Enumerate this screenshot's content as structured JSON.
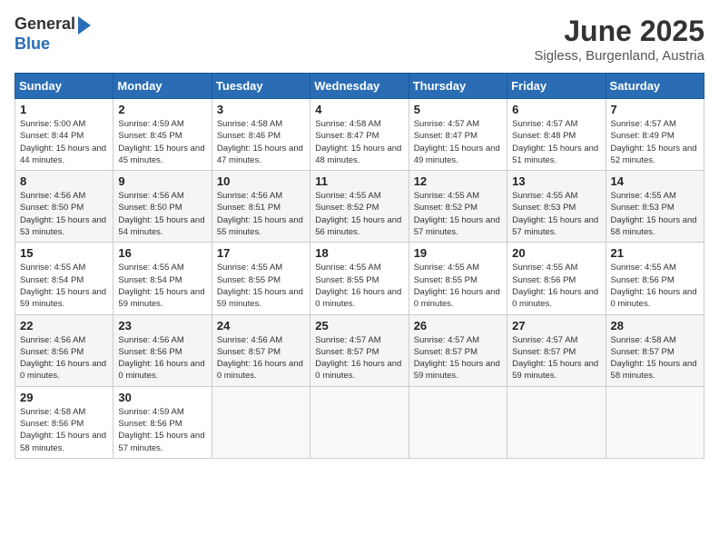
{
  "header": {
    "logo_general": "General",
    "logo_blue": "Blue",
    "month_title": "June 2025",
    "subtitle": "Sigless, Burgenland, Austria"
  },
  "weekdays": [
    "Sunday",
    "Monday",
    "Tuesday",
    "Wednesday",
    "Thursday",
    "Friday",
    "Saturday"
  ],
  "weeks": [
    [
      {
        "day": "1",
        "sunrise": "5:00 AM",
        "sunset": "8:44 PM",
        "daylight": "15 hours and 44 minutes."
      },
      {
        "day": "2",
        "sunrise": "4:59 AM",
        "sunset": "8:45 PM",
        "daylight": "15 hours and 45 minutes."
      },
      {
        "day": "3",
        "sunrise": "4:58 AM",
        "sunset": "8:46 PM",
        "daylight": "15 hours and 47 minutes."
      },
      {
        "day": "4",
        "sunrise": "4:58 AM",
        "sunset": "8:47 PM",
        "daylight": "15 hours and 48 minutes."
      },
      {
        "day": "5",
        "sunrise": "4:57 AM",
        "sunset": "8:47 PM",
        "daylight": "15 hours and 49 minutes."
      },
      {
        "day": "6",
        "sunrise": "4:57 AM",
        "sunset": "8:48 PM",
        "daylight": "15 hours and 51 minutes."
      },
      {
        "day": "7",
        "sunrise": "4:57 AM",
        "sunset": "8:49 PM",
        "daylight": "15 hours and 52 minutes."
      }
    ],
    [
      {
        "day": "8",
        "sunrise": "4:56 AM",
        "sunset": "8:50 PM",
        "daylight": "15 hours and 53 minutes."
      },
      {
        "day": "9",
        "sunrise": "4:56 AM",
        "sunset": "8:50 PM",
        "daylight": "15 hours and 54 minutes."
      },
      {
        "day": "10",
        "sunrise": "4:56 AM",
        "sunset": "8:51 PM",
        "daylight": "15 hours and 55 minutes."
      },
      {
        "day": "11",
        "sunrise": "4:55 AM",
        "sunset": "8:52 PM",
        "daylight": "15 hours and 56 minutes."
      },
      {
        "day": "12",
        "sunrise": "4:55 AM",
        "sunset": "8:52 PM",
        "daylight": "15 hours and 57 minutes."
      },
      {
        "day": "13",
        "sunrise": "4:55 AM",
        "sunset": "8:53 PM",
        "daylight": "15 hours and 57 minutes."
      },
      {
        "day": "14",
        "sunrise": "4:55 AM",
        "sunset": "8:53 PM",
        "daylight": "15 hours and 58 minutes."
      }
    ],
    [
      {
        "day": "15",
        "sunrise": "4:55 AM",
        "sunset": "8:54 PM",
        "daylight": "15 hours and 59 minutes."
      },
      {
        "day": "16",
        "sunrise": "4:55 AM",
        "sunset": "8:54 PM",
        "daylight": "15 hours and 59 minutes."
      },
      {
        "day": "17",
        "sunrise": "4:55 AM",
        "sunset": "8:55 PM",
        "daylight": "15 hours and 59 minutes."
      },
      {
        "day": "18",
        "sunrise": "4:55 AM",
        "sunset": "8:55 PM",
        "daylight": "16 hours and 0 minutes."
      },
      {
        "day": "19",
        "sunrise": "4:55 AM",
        "sunset": "8:55 PM",
        "daylight": "16 hours and 0 minutes."
      },
      {
        "day": "20",
        "sunrise": "4:55 AM",
        "sunset": "8:56 PM",
        "daylight": "16 hours and 0 minutes."
      },
      {
        "day": "21",
        "sunrise": "4:55 AM",
        "sunset": "8:56 PM",
        "daylight": "16 hours and 0 minutes."
      }
    ],
    [
      {
        "day": "22",
        "sunrise": "4:56 AM",
        "sunset": "8:56 PM",
        "daylight": "16 hours and 0 minutes."
      },
      {
        "day": "23",
        "sunrise": "4:56 AM",
        "sunset": "8:56 PM",
        "daylight": "16 hours and 0 minutes."
      },
      {
        "day": "24",
        "sunrise": "4:56 AM",
        "sunset": "8:57 PM",
        "daylight": "16 hours and 0 minutes."
      },
      {
        "day": "25",
        "sunrise": "4:57 AM",
        "sunset": "8:57 PM",
        "daylight": "16 hours and 0 minutes."
      },
      {
        "day": "26",
        "sunrise": "4:57 AM",
        "sunset": "8:57 PM",
        "daylight": "15 hours and 59 minutes."
      },
      {
        "day": "27",
        "sunrise": "4:57 AM",
        "sunset": "8:57 PM",
        "daylight": "15 hours and 59 minutes."
      },
      {
        "day": "28",
        "sunrise": "4:58 AM",
        "sunset": "8:57 PM",
        "daylight": "15 hours and 58 minutes."
      }
    ],
    [
      {
        "day": "29",
        "sunrise": "4:58 AM",
        "sunset": "8:56 PM",
        "daylight": "15 hours and 58 minutes."
      },
      {
        "day": "30",
        "sunrise": "4:59 AM",
        "sunset": "8:56 PM",
        "daylight": "15 hours and 57 minutes."
      },
      null,
      null,
      null,
      null,
      null
    ]
  ]
}
